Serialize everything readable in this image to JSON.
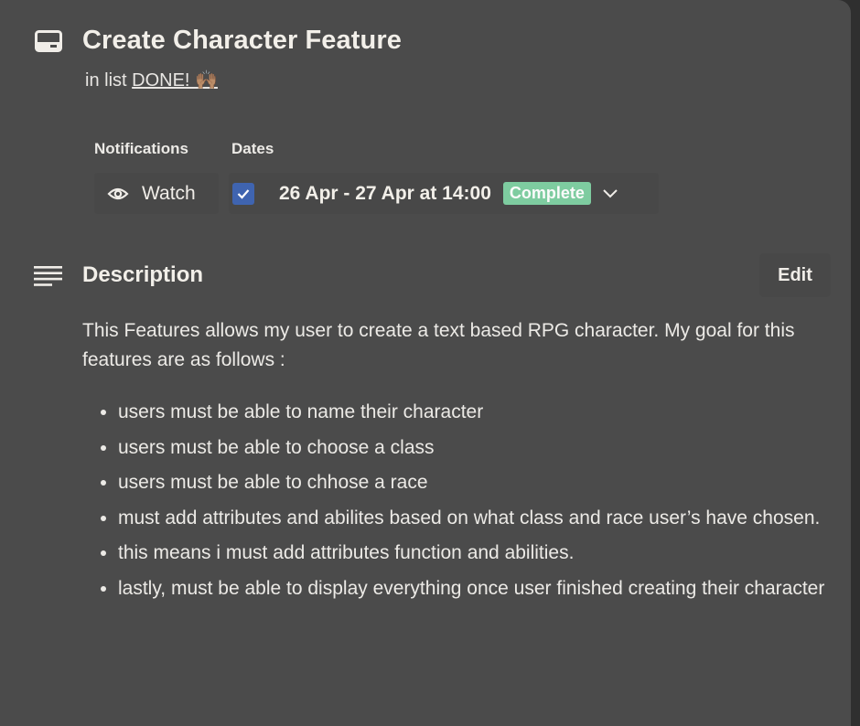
{
  "header": {
    "title": "Create Character Feature",
    "in_list_prefix": "in list",
    "list_name": "DONE! 🙌🏽"
  },
  "notifications": {
    "label": "Notifications",
    "watch_label": "Watch"
  },
  "dates": {
    "label": "Dates",
    "range": "26 Apr - 27 Apr at 14:00",
    "status": "Complete",
    "checked": true
  },
  "description": {
    "title": "Description",
    "edit_label": "Edit",
    "intro": "This Features allows my user to create a text based RPG character. My goal for this features are as follows :",
    "items": [
      "users must be able to name their character",
      "users must be able to choose a class",
      "users must be able to chhose a race",
      "must add attributes and abilites based on what class and race user’s have chosen.",
      "this means i must add attributes function and abilities.",
      "lastly, must be able to display everything once user finished creating their character"
    ]
  },
  "colors": {
    "card_bg": "#4b4b4b",
    "checkbox": "#3f64b0",
    "complete_badge": "#7ecca0"
  }
}
